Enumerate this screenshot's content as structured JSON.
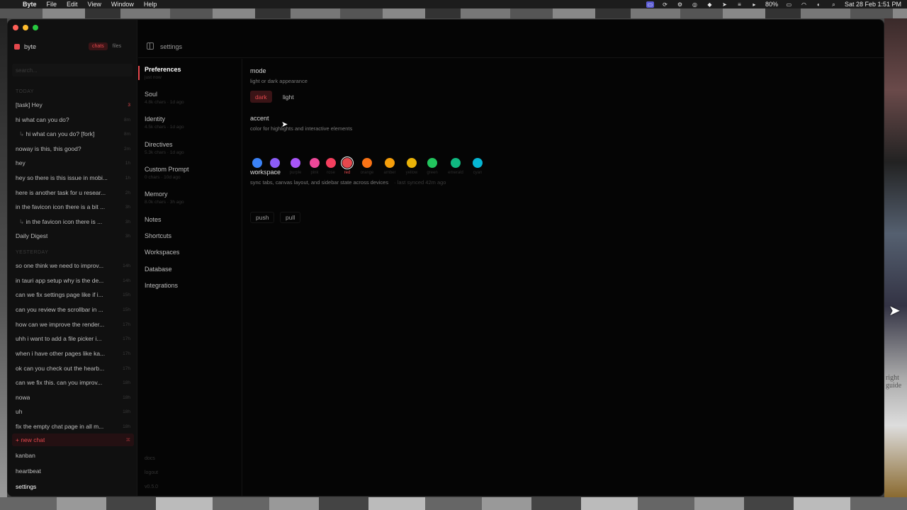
{
  "menubar": {
    "app_name": "Byte",
    "menus": [
      "File",
      "Edit",
      "View",
      "Window",
      "Help"
    ],
    "battery": "80%",
    "datetime": "Sat 28 Feb  1:51 PM"
  },
  "sidebar": {
    "brand": "byte",
    "tabs": {
      "chats": "chats",
      "files": "files"
    },
    "search_placeholder": "search...",
    "today_label": "TODAY",
    "yesterday_label": "YESTERDAY",
    "today": [
      {
        "title": "[task] Hey",
        "age": "3"
      },
      {
        "title": "hi what can you do?",
        "age": "8m"
      },
      {
        "title": "hi what can you do? [fork]",
        "age": "8m"
      },
      {
        "title": "noway is this, this good?",
        "age": "2m"
      },
      {
        "title": "hey",
        "age": "1h"
      },
      {
        "title": "hey so there is this issue in mobi...",
        "age": "1h"
      },
      {
        "title": "here is another task for u resear...",
        "age": "2h"
      },
      {
        "title": "in the favicon icon there is a bit ...",
        "age": "3h"
      },
      {
        "title": "in the favicon icon there is ...",
        "age": "3h"
      },
      {
        "title": "Daily Digest",
        "age": "3h"
      }
    ],
    "yesterday": [
      {
        "title": "so one think we need to improv...",
        "age": "14h"
      },
      {
        "title": "in tauri app setup why is the de...",
        "age": "14h"
      },
      {
        "title": "can we fix settings page like if i...",
        "age": "15h"
      },
      {
        "title": "can you review the scrollbar in ...",
        "age": "15h"
      },
      {
        "title": "how can we improve the render...",
        "age": "17h"
      },
      {
        "title": "uhh i want to add a file picker i...",
        "age": "17h"
      },
      {
        "title": "when i have other pages like ka...",
        "age": "17h"
      },
      {
        "title": "ok can you check out the hearb...",
        "age": "17h"
      },
      {
        "title": "can we fix this. can you improv...",
        "age": "18h"
      },
      {
        "title": "nowa",
        "age": "18h"
      },
      {
        "title": "uh",
        "age": "18h"
      },
      {
        "title": "fix the empty chat page in all m...",
        "age": "18h"
      }
    ],
    "new_chat": {
      "label": "+ new chat",
      "shortcut": "⌘"
    },
    "nav": {
      "kanban": "kanban",
      "heartbeat": "heartbeat",
      "settings": "settings"
    }
  },
  "topbar": {
    "page_label": "settings"
  },
  "settings_nav": {
    "items": [
      {
        "label": "Preferences",
        "meta": "just now"
      },
      {
        "label": "Soul",
        "meta": "4.8k chars · 1d ago"
      },
      {
        "label": "Identity",
        "meta": "4.5k chars · 1d ago"
      },
      {
        "label": "Directives",
        "meta": "5.3k chars · 1d ago"
      },
      {
        "label": "Custom Prompt",
        "meta": "0 chars · 10d ago"
      },
      {
        "label": "Memory",
        "meta": "8.0k chars · 3h ago"
      },
      {
        "label": "Notes",
        "meta": ""
      },
      {
        "label": "Shortcuts",
        "meta": ""
      },
      {
        "label": "Workspaces",
        "meta": ""
      },
      {
        "label": "Database",
        "meta": ""
      },
      {
        "label": "Integrations",
        "meta": ""
      }
    ],
    "footer": {
      "docs": "docs",
      "logout": "logout",
      "version": "v0.5.0"
    }
  },
  "preferences": {
    "mode": {
      "title": "mode",
      "description": "light or dark appearance",
      "options": {
        "dark": "dark",
        "light": "light"
      },
      "selected": "dark"
    },
    "accent": {
      "title": "accent",
      "description": "color for highlights and interactive elements",
      "selected": "red",
      "swatches": [
        {
          "name": "blue",
          "color": "#3b82f6"
        },
        {
          "name": "violet",
          "color": "#8b5cf6"
        },
        {
          "name": "purple",
          "color": "#a855f7"
        },
        {
          "name": "pink",
          "color": "#ec4899"
        },
        {
          "name": "rose",
          "color": "#f43f5e"
        },
        {
          "name": "red",
          "color": "#e5484d"
        },
        {
          "name": "orange",
          "color": "#f97316"
        },
        {
          "name": "amber",
          "color": "#f59e0b"
        },
        {
          "name": "yellow",
          "color": "#eab308"
        },
        {
          "name": "green",
          "color": "#22c55e"
        },
        {
          "name": "emerald",
          "color": "#10b981"
        },
        {
          "name": "cyan",
          "color": "#06b6d4"
        }
      ]
    },
    "workspace": {
      "title": "workspace",
      "description": "sync tabs, canvas layout, and sidebar state across devices",
      "sync_status": "· last synced 42m ago",
      "push": "push",
      "pull": "pull"
    }
  },
  "desktop": {
    "edge_text": "right guide"
  }
}
